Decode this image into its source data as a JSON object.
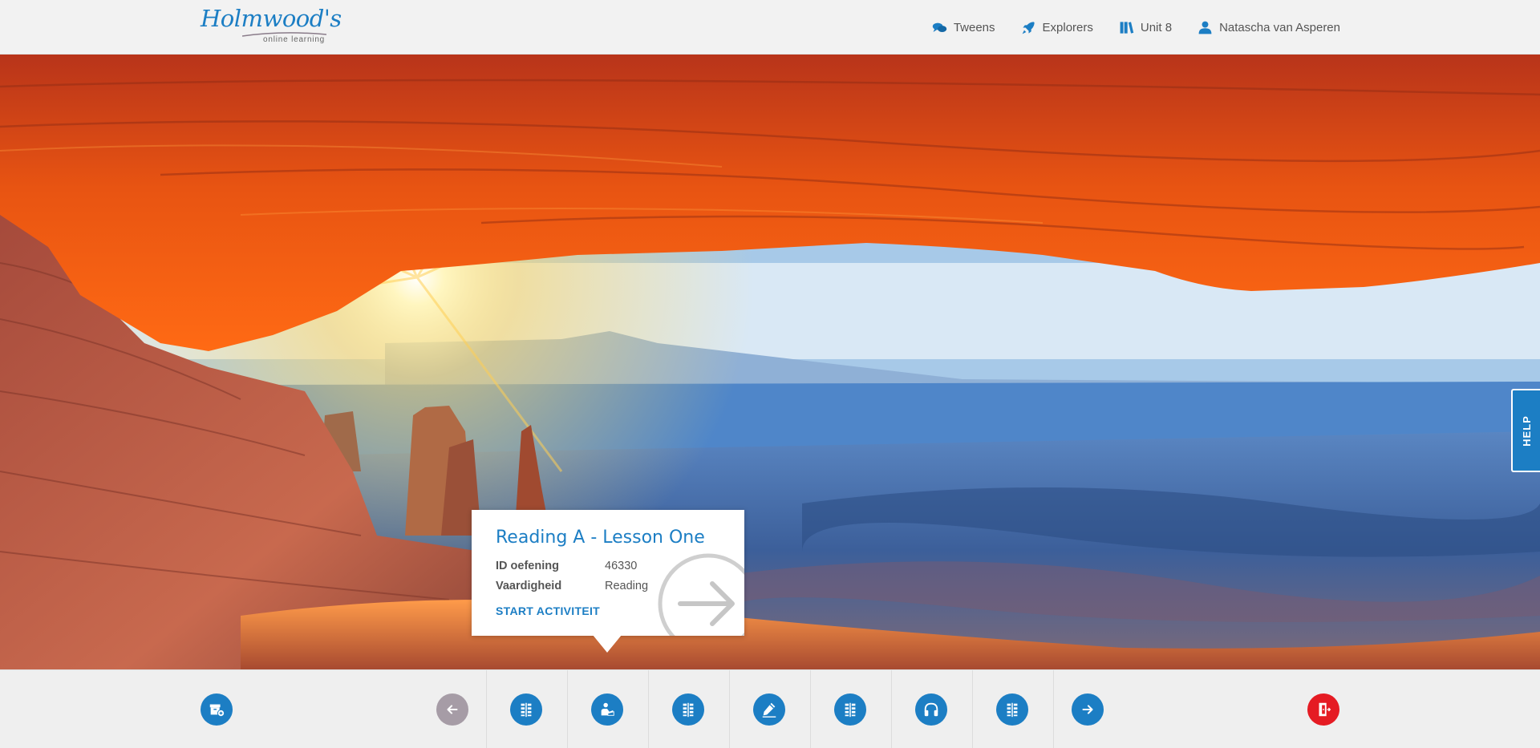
{
  "brand": {
    "logo_script": "Holmwood's",
    "logo_sub": "online learning"
  },
  "nav": [
    {
      "label": "Tweens",
      "icon": "chat-bubbles-icon"
    },
    {
      "label": "Explorers",
      "icon": "rocket-icon"
    },
    {
      "label": "Unit 8",
      "icon": "books-icon"
    },
    {
      "label": "Natascha van Asperen",
      "icon": "user-icon"
    }
  ],
  "help": {
    "label": "HELP"
  },
  "activity": {
    "title": "Reading A - Lesson One",
    "id_label": "ID oefening",
    "id_value": "46330",
    "skill_label": "Vaardigheid",
    "skill_value": "Reading",
    "start_label": "START ACTIVITEIT"
  },
  "footer": {
    "buttons": [
      {
        "icon": "archive-icon"
      },
      {
        "icon": "arrow-left-icon",
        "state": "disabled"
      },
      {
        "icon": "grid-icon"
      },
      {
        "icon": "reading-icon"
      },
      {
        "icon": "grid-icon"
      },
      {
        "icon": "pencil-icon"
      },
      {
        "icon": "grid-icon"
      },
      {
        "icon": "headphones-icon"
      },
      {
        "icon": "grid-icon"
      },
      {
        "icon": "arrow-right-icon"
      },
      {
        "icon": "exit-door-icon"
      }
    ]
  },
  "colors": {
    "accent": "#1c7ec4",
    "exit": "#e51b23",
    "disabled": "#a69ca6"
  }
}
